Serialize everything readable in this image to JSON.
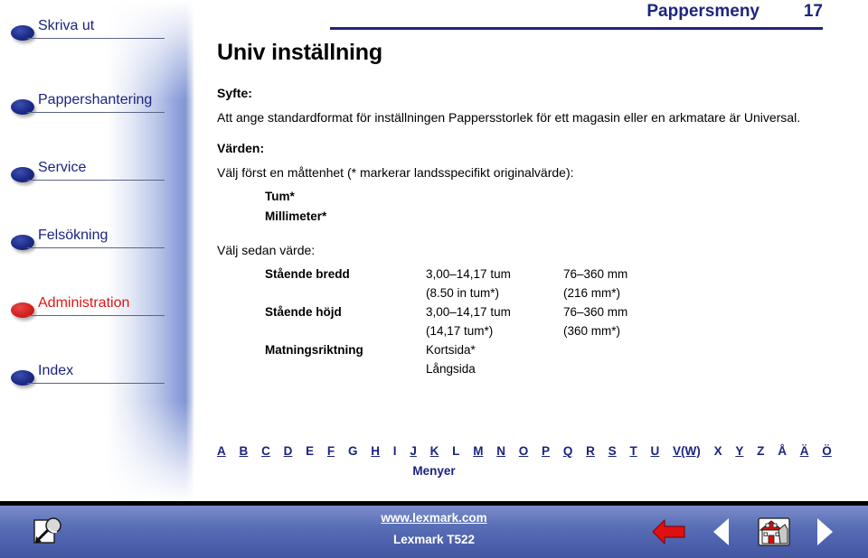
{
  "header": {
    "title": "Pappersmeny",
    "page_number": "17"
  },
  "sidebar": {
    "items": [
      {
        "label": "Skriva ut",
        "state": "normal",
        "bullet": "bullet-icon"
      },
      {
        "label": "Pappershantering",
        "state": "normal",
        "bullet": "bullet-icon"
      },
      {
        "label": "Service",
        "state": "normal",
        "bullet": "bullet-icon"
      },
      {
        "label": "Felsökning",
        "state": "normal",
        "bullet": "bullet-icon"
      },
      {
        "label": "Administration",
        "state": "current",
        "bullet": "bullet-icon"
      },
      {
        "label": "Index",
        "state": "normal",
        "bullet": "bullet-icon"
      }
    ]
  },
  "main": {
    "page_title": "Univ inställning",
    "purpose_heading": "Syfte:",
    "purpose_body": "Att ange standardformat för inställningen Pappersstorlek för ett magasin eller en arkmatare är Universal.",
    "values_heading": "Värden:",
    "unit_intro": "Välj först en måttenhet (* markerar landsspecifikt originalvärde):",
    "units": [
      "Tum*",
      "Millimeter*"
    ],
    "value_intro": "Välj sedan värde:",
    "value_rows": [
      {
        "label": "Stående bredd",
        "col1": "3,00–14,17 tum",
        "col2": "76–360 mm"
      },
      {
        "label": "",
        "col1": "(8.50 in tum*)",
        "col2": "(216 mm*)"
      },
      {
        "label": "Stående höjd",
        "col1": "3,00–14,17 tum",
        "col2": "76–360 mm"
      },
      {
        "label": "",
        "col1": "(14,17 tum*)",
        "col2": "(360 mm*)"
      },
      {
        "label": "Matningsriktning",
        "col1": "Kortsida*",
        "col2": ""
      },
      {
        "label": "",
        "col1": "Långsida",
        "col2": ""
      }
    ]
  },
  "index_bar": {
    "letters": [
      {
        "char": "A",
        "linked": true
      },
      {
        "char": "B",
        "linked": true
      },
      {
        "char": "C",
        "linked": true
      },
      {
        "char": "D",
        "linked": true
      },
      {
        "char": "E",
        "linked": false
      },
      {
        "char": "F",
        "linked": true
      },
      {
        "char": "G",
        "linked": false
      },
      {
        "char": "H",
        "linked": true
      },
      {
        "char": "I",
        "linked": false
      },
      {
        "char": "J",
        "linked": true
      },
      {
        "char": "K",
        "linked": true
      },
      {
        "char": "L",
        "linked": false
      },
      {
        "char": "M",
        "linked": true
      },
      {
        "char": "N",
        "linked": true
      },
      {
        "char": "O",
        "linked": true
      },
      {
        "char": "P",
        "linked": true
      },
      {
        "char": "Q",
        "linked": true
      },
      {
        "char": "R",
        "linked": true
      },
      {
        "char": "S",
        "linked": true
      },
      {
        "char": "T",
        "linked": true
      },
      {
        "char": "U",
        "linked": true
      },
      {
        "char": "V(W)",
        "linked": true
      },
      {
        "char": "X",
        "linked": false
      },
      {
        "char": "Y",
        "linked": true
      },
      {
        "char": "Z",
        "linked": false
      },
      {
        "char": "Å",
        "linked": false
      },
      {
        "char": "Ä",
        "linked": true
      },
      {
        "char": "Ö",
        "linked": true
      }
    ],
    "caption": "Menyer"
  },
  "footer": {
    "website": "www.lexmark.com",
    "model": "Lexmark T522",
    "icons": {
      "search": "document-search-icon",
      "back": "red-back-arrow-icon",
      "prev": "previous-page-icon",
      "home": "home-icon",
      "next": "next-page-icon"
    }
  },
  "colors": {
    "navy": "#1c2480",
    "current_red": "#e01616",
    "footer_blue": "#4d61ad"
  }
}
